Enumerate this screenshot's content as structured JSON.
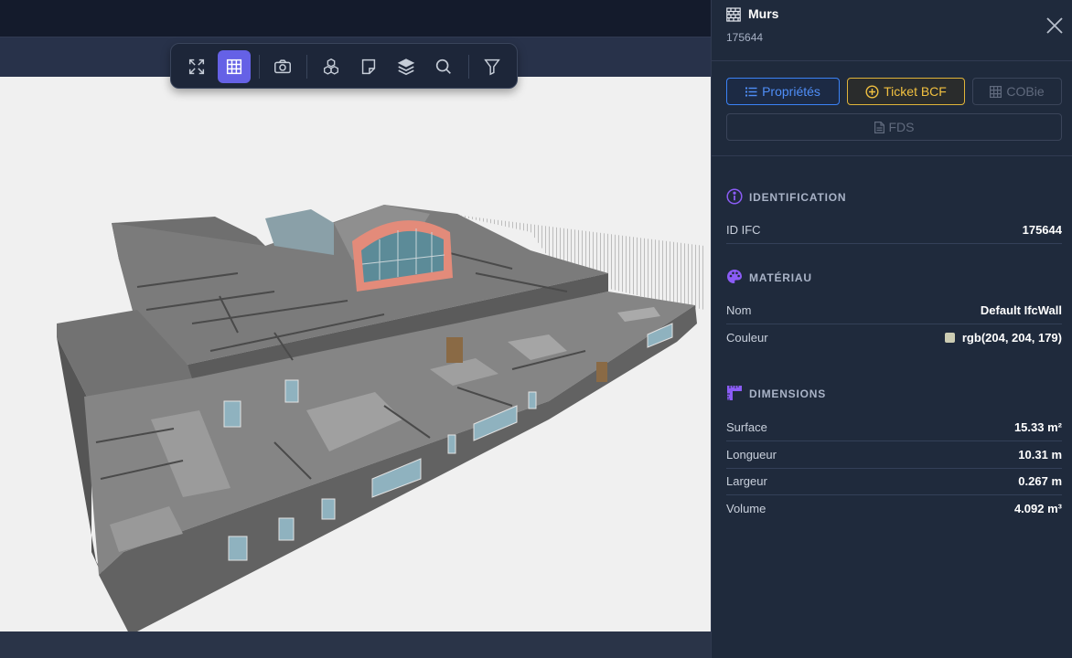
{
  "toolbar": {
    "buttons": [
      {
        "icon": "fullscreen-icon",
        "active": false
      },
      {
        "icon": "grid-icon",
        "active": true
      },
      {
        "icon": "camera-icon",
        "active": false
      },
      {
        "icon": "cubes-icon",
        "active": false
      },
      {
        "icon": "sticky-note-icon",
        "active": false
      },
      {
        "icon": "layers-icon",
        "active": false
      },
      {
        "icon": "search-icon",
        "active": false
      },
      {
        "icon": "filter-icon",
        "active": false
      }
    ]
  },
  "panel": {
    "title": "Murs",
    "subtitle": "175644",
    "icon": "wall-icon",
    "tabs": {
      "props": "Propriétés",
      "bcf": "Ticket BCF",
      "cobie": "COBie",
      "fds": "FDS"
    },
    "sections": {
      "identification": {
        "title": "IDENTIFICATION",
        "rows": [
          {
            "label": "ID IFC",
            "value": "175644"
          }
        ]
      },
      "material": {
        "title": "MATÉRIAU",
        "rows": [
          {
            "label": "Nom",
            "value": "Default IfcWall"
          },
          {
            "label": "Couleur",
            "value": "rgb(204, 204, 179)"
          }
        ]
      },
      "dimensions": {
        "title": "DIMENSIONS",
        "rows": [
          {
            "label": "Surface",
            "value": "15.33 m²"
          },
          {
            "label": "Longueur",
            "value": "10.31 m"
          },
          {
            "label": "Largeur",
            "value": "0.267 m"
          },
          {
            "label": "Volume",
            "value": "4.092 m³"
          }
        ]
      }
    }
  },
  "colors": {
    "accent": "#6561e6",
    "props_blue": "#3b82f6",
    "bcf_yellow": "#e0b43a",
    "material_swatch": "#ccccb3",
    "section_icon": "#8b5cf6"
  }
}
